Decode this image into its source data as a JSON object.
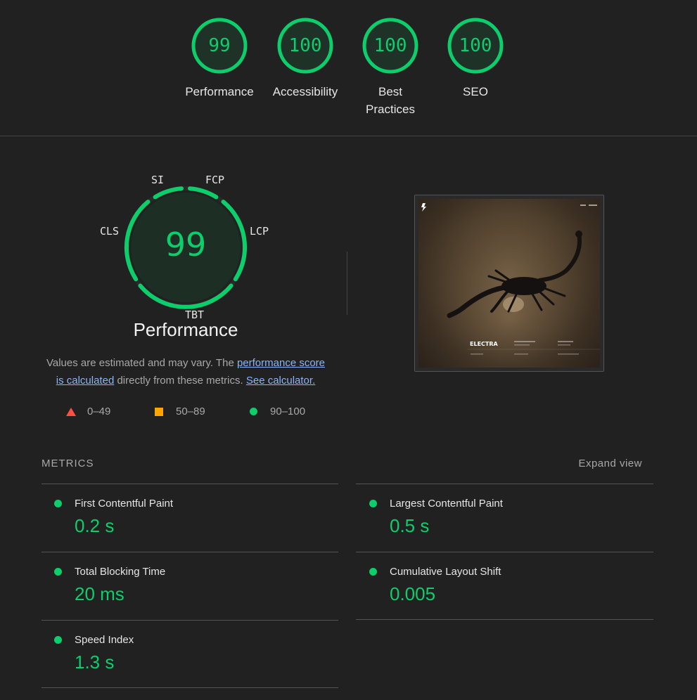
{
  "categories": [
    {
      "score": "99",
      "label": "Performance"
    },
    {
      "score": "100",
      "label": "Accessibility"
    },
    {
      "score": "100",
      "label": "Best Practices",
      "label_line1": "Best",
      "label_line2": "Practices"
    },
    {
      "score": "100",
      "label": "SEO"
    }
  ],
  "performance": {
    "score": "99",
    "title": "Performance",
    "metric_tags": {
      "si": "SI",
      "fcp": "FCP",
      "lcp": "LCP",
      "tbt": "TBT",
      "cls": "CLS"
    },
    "description": {
      "part1": "Values are estimated and may vary. The ",
      "link1": "performance score is calculated",
      "part2": " directly from these metrics. ",
      "link2": "See calculator."
    },
    "legend": {
      "fail": "0–49",
      "average": "50–89",
      "pass": "90–100"
    }
  },
  "screenshot": {
    "brand": "ELECTRA"
  },
  "metrics": {
    "heading": "METRICS",
    "expand_label": "Expand view",
    "items": [
      {
        "name": "First Contentful Paint",
        "value": "0.2 s"
      },
      {
        "name": "Largest Contentful Paint",
        "value": "0.5 s"
      },
      {
        "name": "Total Blocking Time",
        "value": "20 ms"
      },
      {
        "name": "Cumulative Layout Shift",
        "value": "0.005"
      },
      {
        "name": "Speed Index",
        "value": "1.3 s"
      }
    ]
  },
  "colors": {
    "pass": "#0cce6b",
    "average": "#ffa400",
    "fail": "#ff4e42",
    "link": "#8ab4f8",
    "background": "#212121"
  }
}
